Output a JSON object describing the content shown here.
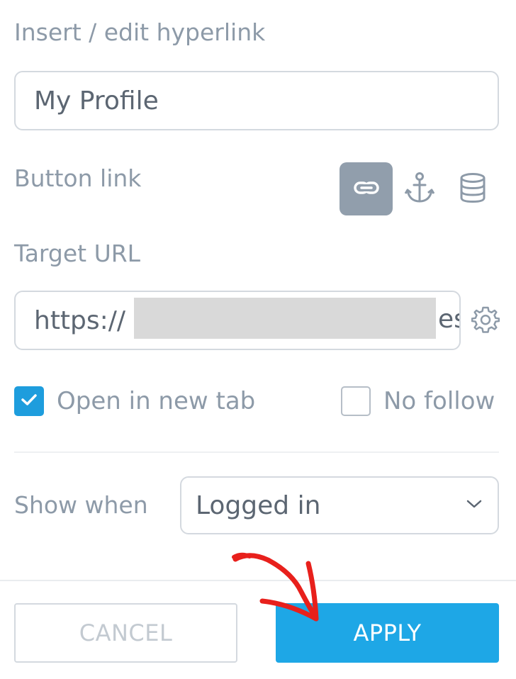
{
  "dialog": {
    "title": "Insert / edit hyperlink"
  },
  "link_text": {
    "value": "My Profile"
  },
  "button_link": {
    "label": "Button link",
    "types": [
      {
        "icon": "link-icon",
        "active": true
      },
      {
        "icon": "anchor-icon",
        "active": false
      },
      {
        "icon": "database-icon",
        "active": false
      }
    ]
  },
  "target_url": {
    "label": "Target URL",
    "value_prefix": "https://",
    "visible_tail": "es",
    "redacted": true
  },
  "options": {
    "open_new_tab": {
      "label": "Open in new tab",
      "checked": true
    },
    "no_follow": {
      "label": "No follow",
      "checked": false
    }
  },
  "show_when": {
    "label": "Show when",
    "selected": "Logged in"
  },
  "actions": {
    "cancel_label": "CANCEL",
    "apply_label": "APPLY"
  },
  "colors": {
    "accent": "#1ea7e6",
    "checkbox_checked": "#1e9ddd",
    "active_type_bg": "#919eac",
    "annotation_arrow": "#e8201c"
  }
}
